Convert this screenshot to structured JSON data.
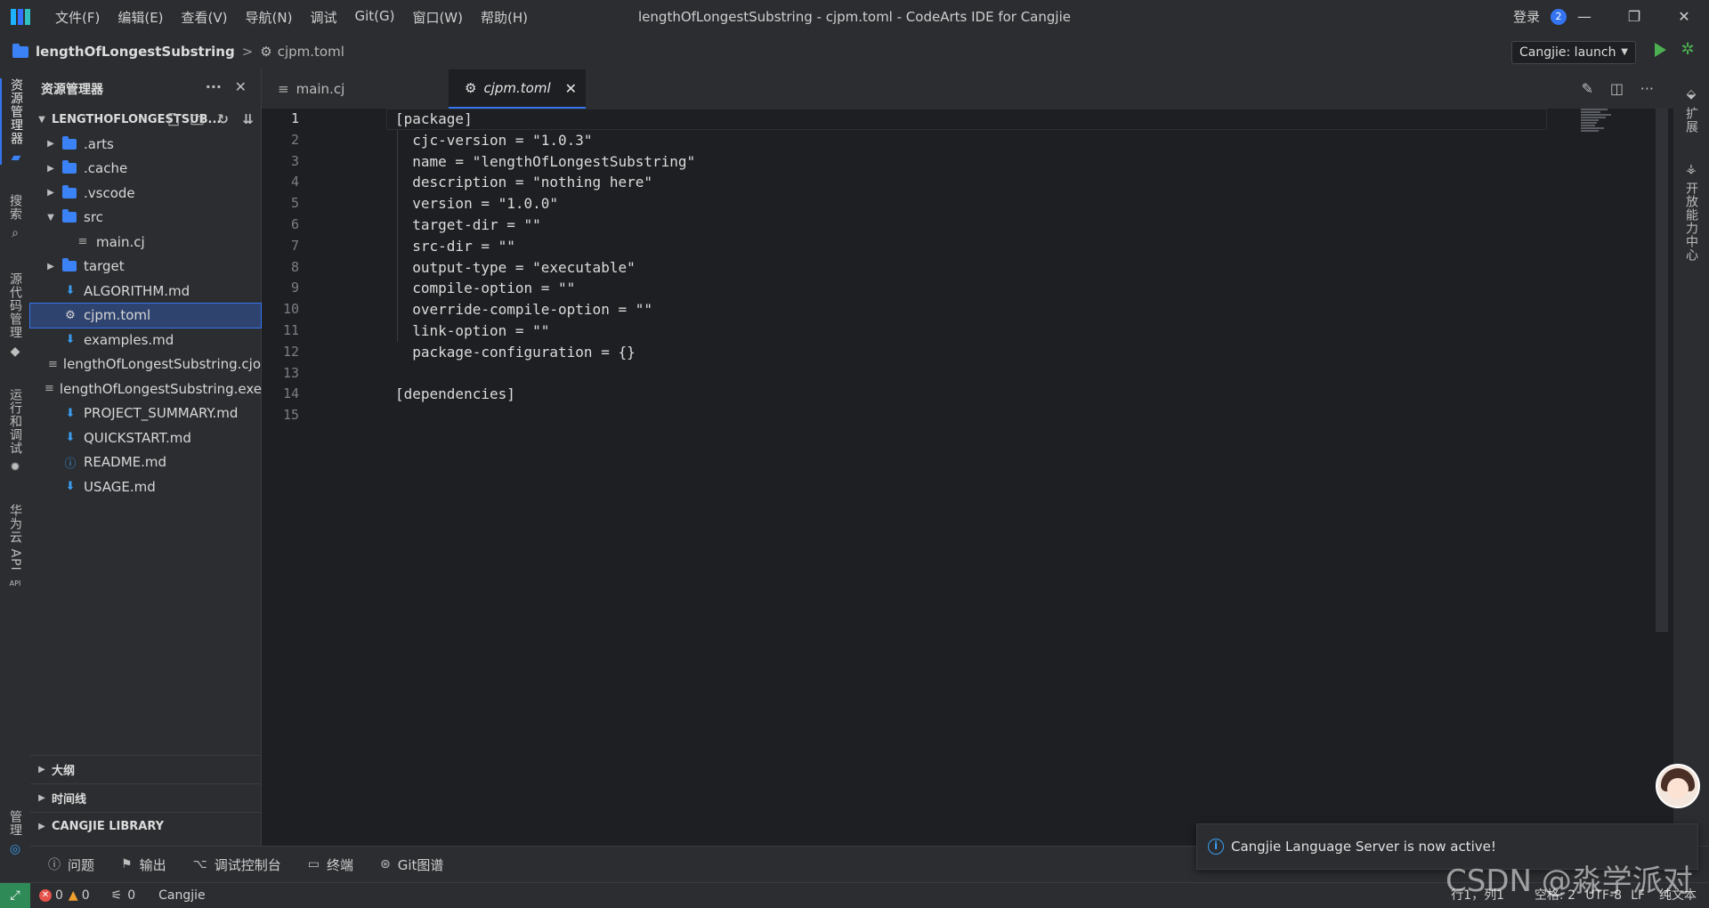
{
  "window": {
    "menu": [
      "文件(F)",
      "编辑(E)",
      "查看(V)",
      "导航(N)",
      "调试",
      "Git(G)",
      "窗口(W)",
      "帮助(H)"
    ],
    "title": "lengthOfLongestSubstring - cjpm.toml - CodeArts IDE for Cangjie",
    "login": "登录",
    "notification_count": "2",
    "controls": [
      "—",
      "❐",
      "✕"
    ]
  },
  "breadcrumb": {
    "project": "lengthOfLongestSubstring",
    "separator": ">",
    "file": "cjpm.toml"
  },
  "run_config": {
    "selected": "Cangjie: launch"
  },
  "activity_bar": {
    "items": [
      "资源管理器",
      "搜索",
      "源代码管理",
      "运行和调试",
      "华为云 API",
      "管理"
    ]
  },
  "right_bar": {
    "items": [
      "扩展",
      "开放能力中心"
    ]
  },
  "sidebar": {
    "title": "资源管理器",
    "project_name": "LENGTHOFLONGESTSUB...",
    "tree": [
      {
        "label": ".arts",
        "type": "folder",
        "depth": 0,
        "expanded": false
      },
      {
        "label": ".cache",
        "type": "folder",
        "depth": 0,
        "expanded": false
      },
      {
        "label": ".vscode",
        "type": "folder",
        "depth": 0,
        "expanded": false
      },
      {
        "label": "src",
        "type": "folder",
        "depth": 0,
        "expanded": true
      },
      {
        "label": "main.cj",
        "type": "file",
        "depth": 1,
        "icon": "lines"
      },
      {
        "label": "target",
        "type": "folder",
        "depth": 0,
        "expanded": false
      },
      {
        "label": "ALGORITHM.md",
        "type": "file",
        "depth": 0,
        "icon": "md"
      },
      {
        "label": "cjpm.toml",
        "type": "file",
        "depth": 0,
        "icon": "gear",
        "selected": true
      },
      {
        "label": "examples.md",
        "type": "file",
        "depth": 0,
        "icon": "md"
      },
      {
        "label": "lengthOfLongestSubstring.cjo",
        "type": "file",
        "depth": 0,
        "icon": "lines"
      },
      {
        "label": "lengthOfLongestSubstring.exe",
        "type": "file",
        "depth": 0,
        "icon": "lines"
      },
      {
        "label": "PROJECT_SUMMARY.md",
        "type": "file",
        "depth": 0,
        "icon": "md"
      },
      {
        "label": "QUICKSTART.md",
        "type": "file",
        "depth": 0,
        "icon": "md"
      },
      {
        "label": "README.md",
        "type": "file",
        "depth": 0,
        "icon": "info"
      },
      {
        "label": "USAGE.md",
        "type": "file",
        "depth": 0,
        "icon": "md"
      }
    ],
    "sections": [
      "大纲",
      "时间线",
      "CANGJIE LIBRARY"
    ]
  },
  "tabs": [
    {
      "label": "main.cj",
      "active": false
    },
    {
      "label": "cjpm.toml",
      "active": true,
      "close": "✕"
    }
  ],
  "editor": {
    "lines": [
      "[package]",
      "  cjc-version = \"1.0.3\"",
      "  name = \"lengthOfLongestSubstring\"",
      "  description = \"nothing here\"",
      "  version = \"1.0.0\"",
      "  target-dir = \"\"",
      "  src-dir = \"\"",
      "  output-type = \"executable\"",
      "  compile-option = \"\"",
      "  override-compile-option = \"\"",
      "  link-option = \"\"",
      "  package-configuration = {}",
      "",
      "[dependencies]",
      ""
    ],
    "current_line": 1
  },
  "panel_tabs": [
    "问题",
    "输出",
    "调试控制台",
    "终端",
    "Git图谱"
  ],
  "status": {
    "errors": "0",
    "warnings": "0",
    "ports": "0",
    "language_name": "Cangjie",
    "position": "行1，列1",
    "spaces": "空格: 2",
    "encoding": "UTF-8",
    "eol": "LF",
    "mode": "纯文本"
  },
  "toast": {
    "message": "Cangjie Language Server is now active!"
  },
  "watermark": "CSDN @淼学派对"
}
